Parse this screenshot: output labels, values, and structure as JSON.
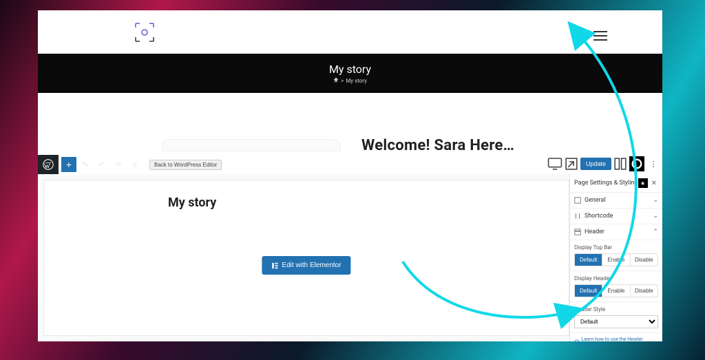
{
  "preview": {
    "page_title": "My story",
    "breadcrumb_sep": ">",
    "breadcrumb_current": "My story",
    "welcome_text": "Welcome! Sara Here…"
  },
  "toolbar": {
    "back_label": "Back to WordPress Editor",
    "update_label": "Update"
  },
  "editor": {
    "title": "My story",
    "elementor_label": "Edit with Elementor"
  },
  "sidebar": {
    "panel_title": "Page Settings & Styling",
    "rows": {
      "general": "General",
      "shortcode": "Shortcode",
      "header": "Header"
    },
    "display_top_bar": {
      "label": "Display Top Bar",
      "options": [
        "Default",
        "Enable",
        "Disable"
      ],
      "active": 0
    },
    "display_header": {
      "label": "Display Header",
      "options": [
        "Default",
        "Enable",
        "Disable"
      ],
      "active": 0
    },
    "header_style": {
      "label": "Header Style",
      "selected": "Default"
    },
    "learn_link": "Learn how to use the Header settings"
  }
}
